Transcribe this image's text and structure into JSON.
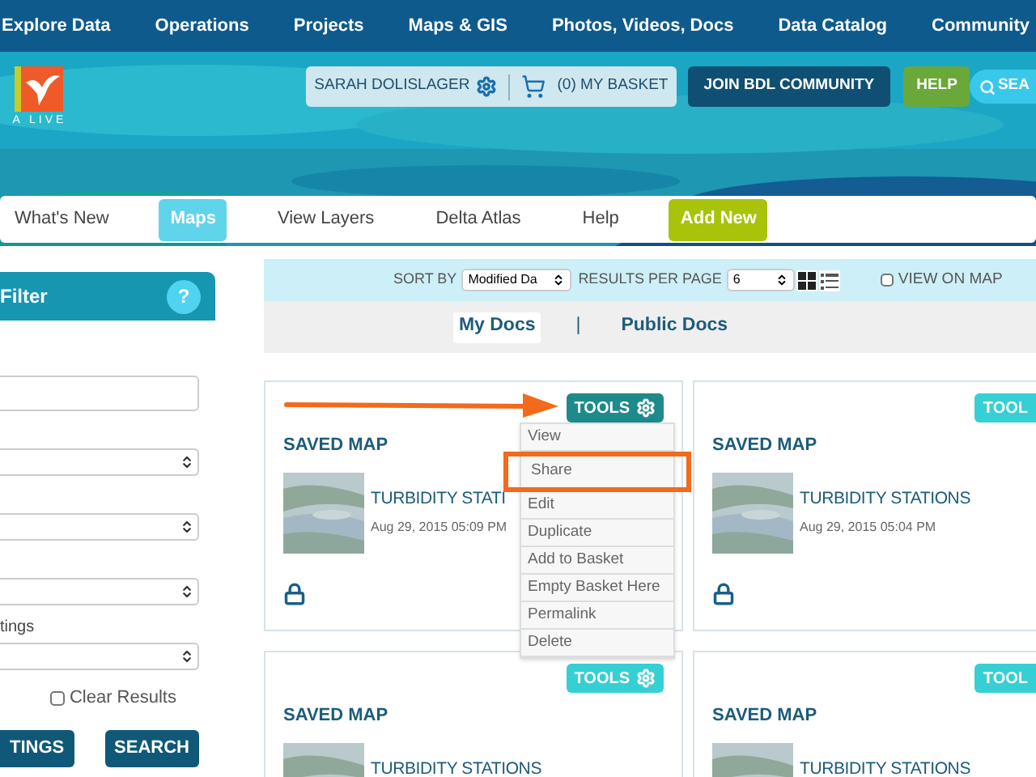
{
  "top_nav": [
    "Explore Data",
    "Operations",
    "Projects",
    "Maps & GIS",
    "Photos, Videos, Docs",
    "Data Catalog",
    "Community"
  ],
  "logo": {
    "text": "A LIVE"
  },
  "user_bar": {
    "user": "SARAH DOLISLAGER",
    "basket": "(0) MY BASKET"
  },
  "join_button": "JOIN BDL COMMUNITY",
  "help_button": "HELP",
  "search_button": "SEA",
  "sub_nav": [
    {
      "label": "What's New",
      "kind": "tab",
      "selected": false
    },
    {
      "label": "Maps",
      "kind": "tab",
      "selected": true
    },
    {
      "label": "View Layers",
      "kind": "tab",
      "selected": false
    },
    {
      "label": "Delta Atlas",
      "kind": "tab",
      "selected": false
    },
    {
      "label": "Help",
      "kind": "tab",
      "selected": false
    },
    {
      "label": "Add New",
      "kind": "action"
    }
  ],
  "filter": {
    "title": "Filter",
    "help": "?",
    "fields": [
      {
        "kind": "input"
      },
      {
        "kind": "select"
      },
      {
        "kind": "select"
      },
      {
        "kind": "select"
      },
      {
        "kind": "select",
        "label": "tings"
      }
    ],
    "clear_results": {
      "label": "Clear Results",
      "checked": false
    },
    "buttons": [
      "TINGS",
      "SEARCH"
    ]
  },
  "sort_bar": {
    "sort_label": "SORT BY",
    "sort_value": "Modified Da",
    "per_page_label": "RESULTS PER PAGE",
    "per_page_value": "6",
    "view_modes": [
      {
        "kind": "grid",
        "selected": true
      },
      {
        "kind": "list",
        "selected": false
      }
    ],
    "view_on_map": {
      "label": "VIEW ON MAP",
      "checked": false
    }
  },
  "doc_tabs": [
    {
      "label": "My Docs",
      "selected": true
    },
    {
      "label": "Public Docs",
      "selected": false
    }
  ],
  "doc_tab_separator": "|",
  "cards": [
    {
      "tools": "TOOLS",
      "tools_active": true,
      "type": "SAVED MAP",
      "title": "TURBIDITY STATI",
      "date": "Aug 29, 2015 05:09 PM",
      "locked": true
    },
    {
      "tools": "TOOL",
      "tools_active": false,
      "type": "SAVED MAP",
      "title": "TURBIDITY STATIONS",
      "date": "Aug 29, 2015 05:04 PM",
      "locked": true
    },
    {
      "tools": "TOOLS",
      "tools_active": false,
      "type": "SAVED MAP",
      "title": "TURBIDITY STATIONS"
    },
    {
      "tools": "TOOL",
      "tools_active": false,
      "type": "SAVED MAP",
      "title": "TURBIDITY STATIONS"
    }
  ],
  "tools_menu": [
    {
      "label": "View",
      "highlighted": false
    },
    {
      "label": "Share",
      "highlighted": true
    },
    {
      "label": "Edit",
      "highlighted": false
    },
    {
      "label": "Duplicate",
      "highlighted": false
    },
    {
      "label": "Add to Basket",
      "highlighted": false
    },
    {
      "label": "Empty Basket Here",
      "highlighted": false
    },
    {
      "label": "Permalink",
      "highlighted": false
    },
    {
      "label": "Delete",
      "highlighted": false
    }
  ]
}
